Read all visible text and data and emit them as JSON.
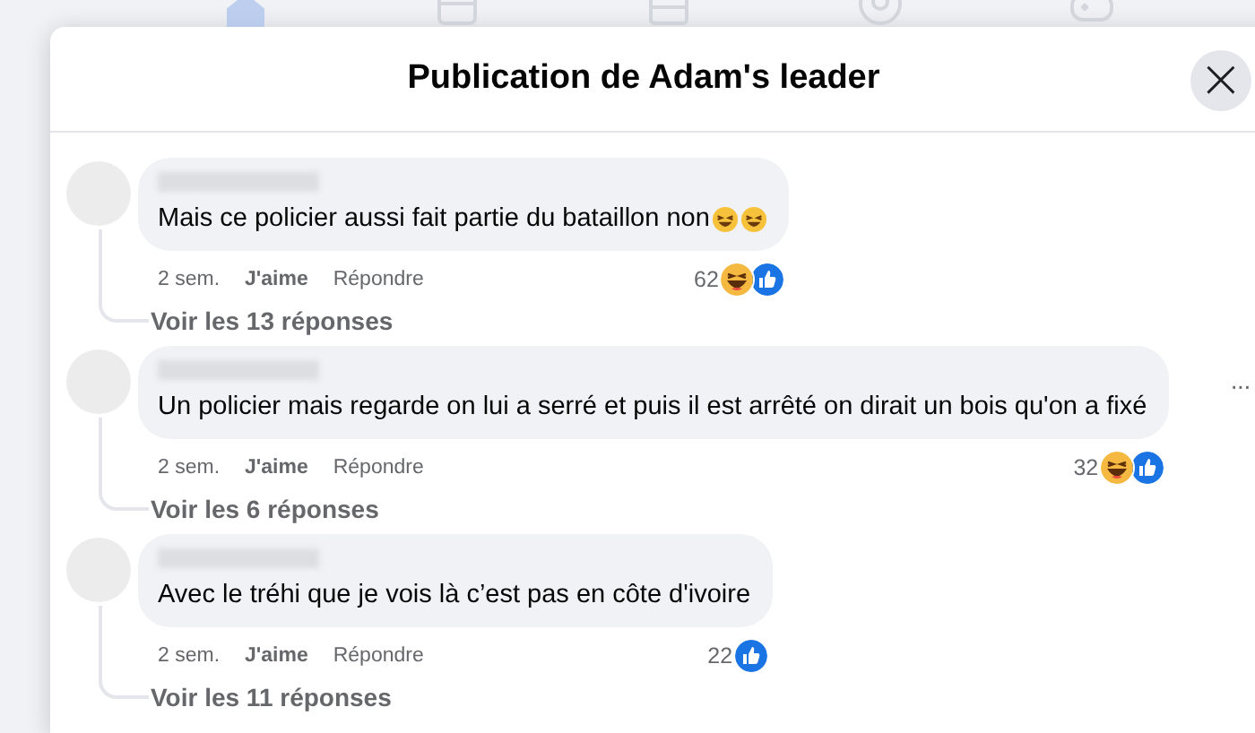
{
  "top_nav": {
    "items": [
      {
        "kind": "home",
        "selected": true
      },
      {
        "kind": "video",
        "selected": false
      },
      {
        "kind": "store",
        "selected": false
      },
      {
        "kind": "groups",
        "selected": false
      },
      {
        "kind": "gaming",
        "selected": false
      }
    ]
  },
  "dialog": {
    "title": "Publication de Adam's leader",
    "close_label": "×"
  },
  "comments": [
    {
      "text": "Mais ce policier aussi fait partie du bataillon non",
      "text_emoji": [
        {
          "kind": "laughing"
        },
        {
          "kind": "laughing"
        }
      ],
      "time": "2 sem.",
      "like_label": "J'aime",
      "reply_label": "Répondre",
      "reaction_count": "62",
      "reactions": [
        {
          "kind": "haha"
        },
        {
          "kind": "like"
        }
      ],
      "replies_label": "Voir les 13 réponses"
    },
    {
      "text": "Un policier mais regarde on lui a serré et puis il est arrêté on dirait un bois qu'on a fixé",
      "time": "2 sem.",
      "like_label": "J'aime",
      "reply_label": "Répondre",
      "reaction_count": "32",
      "reactions": [
        {
          "kind": "haha"
        },
        {
          "kind": "like"
        }
      ],
      "menu_label": "···",
      "replies_label": "Voir les 6 réponses"
    },
    {
      "text": "Avec le tréhi que je vois là c’est pas en côte d'ivoire",
      "time": "2 sem.",
      "like_label": "J'aime",
      "reply_label": "Répondre",
      "reaction_count": "22",
      "reactions": [
        {
          "kind": "like"
        }
      ],
      "replies_label": "Voir les 11 réponses"
    }
  ]
}
